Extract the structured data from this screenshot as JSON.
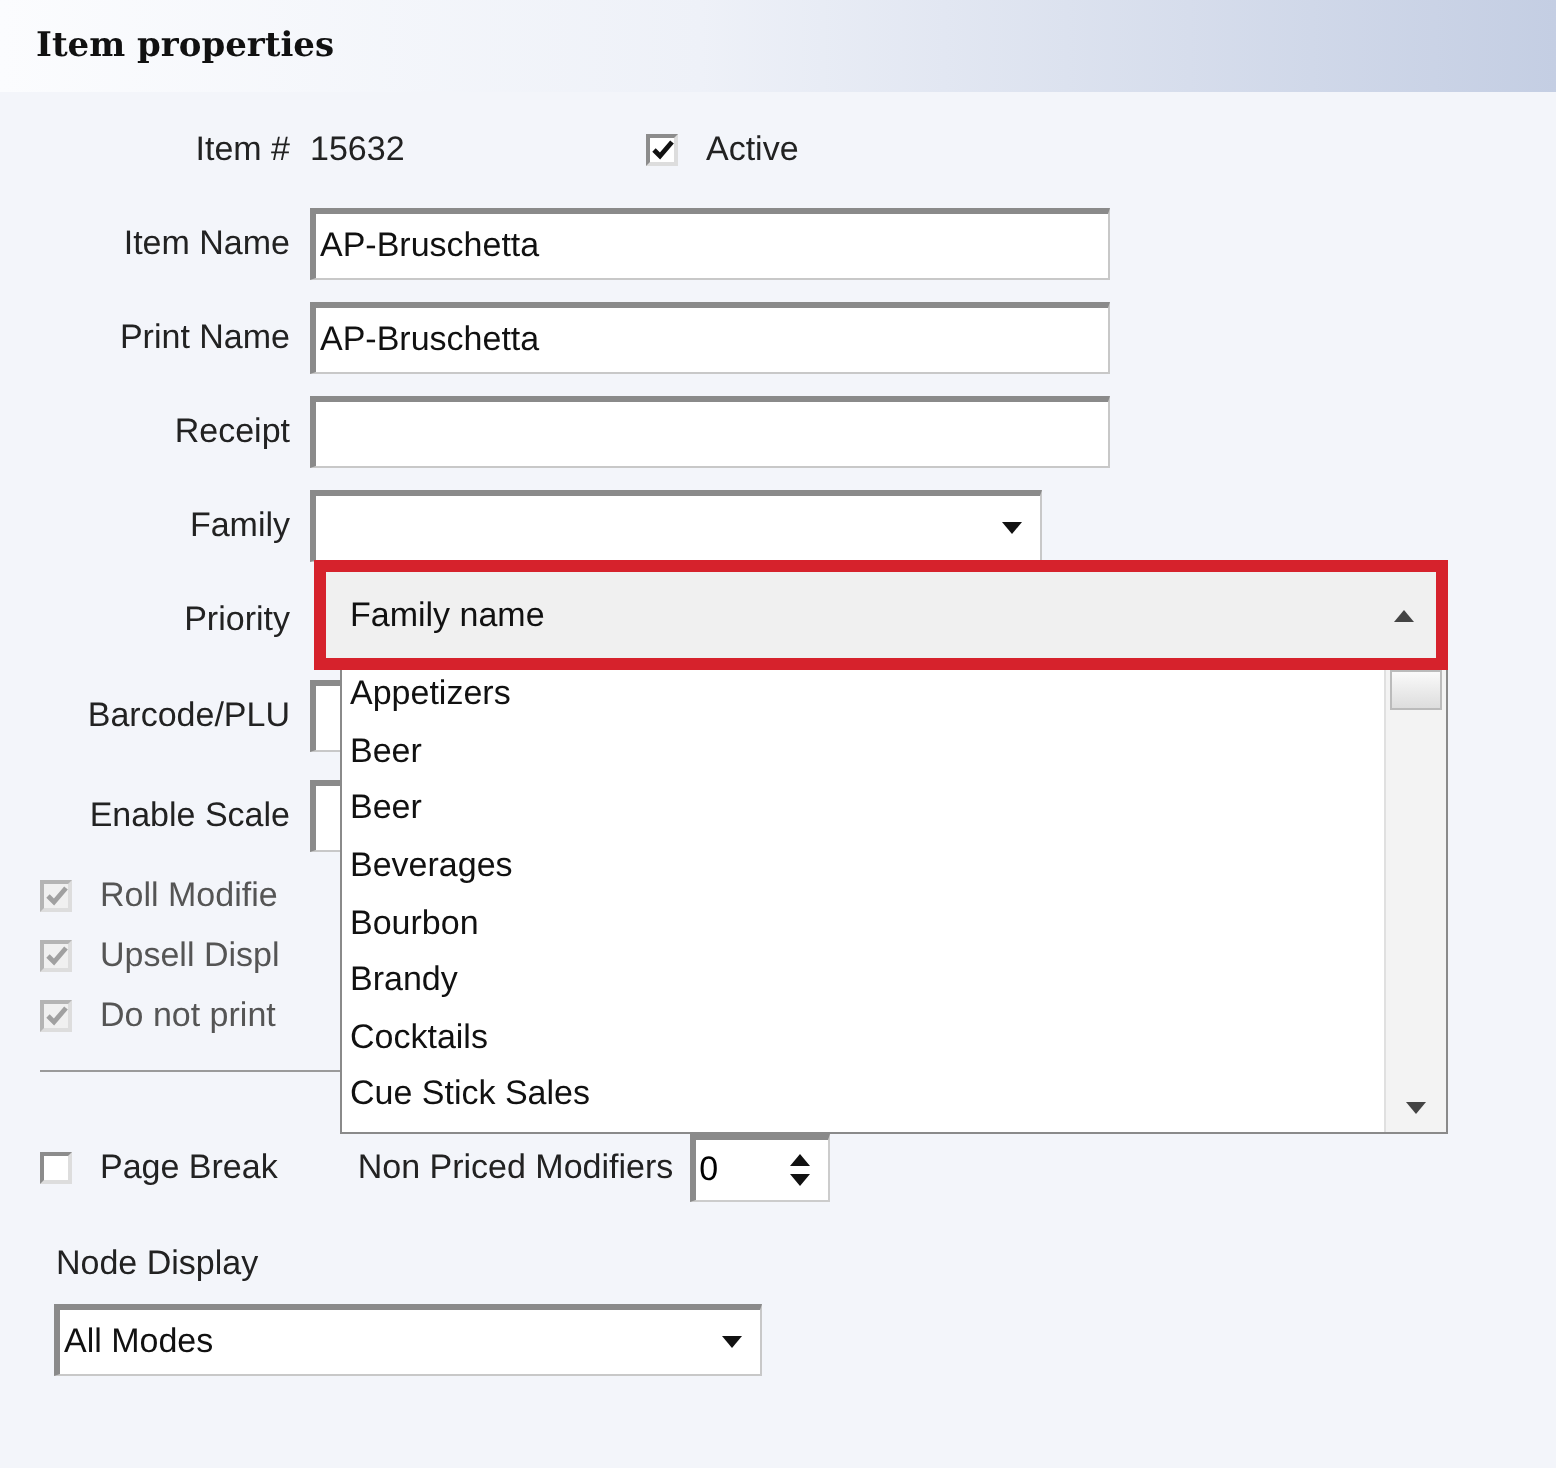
{
  "panel": {
    "title": "Item properties"
  },
  "item_number": {
    "label": "Item #",
    "value": "15632"
  },
  "active": {
    "label": "Active",
    "checked": true
  },
  "fields": [
    {
      "label": "Item Name",
      "kind": "text",
      "value": "AP-Bruschetta"
    },
    {
      "label": "Print Name",
      "kind": "text",
      "value": "AP-Bruschetta"
    },
    {
      "label": "Receipt",
      "kind": "text"
    },
    {
      "label": "Family",
      "kind": "combo"
    },
    {
      "label": "Priority",
      "kind": "covered"
    },
    {
      "label": "Barcode/PLU",
      "kind": "text"
    },
    {
      "label": "Enable Scale",
      "kind": "text"
    }
  ],
  "options": [
    {
      "label": "Roll Modifie",
      "checked": true,
      "disabled": true
    },
    {
      "label": "Upsell Displ",
      "checked": true,
      "disabled": true
    },
    {
      "label": "Do not print",
      "checked": true,
      "disabled": true
    }
  ],
  "dropdown": {
    "header": "Family name",
    "highlighted": true,
    "items": [
      "Appetizers",
      "Beer",
      "Beer",
      "Beverages",
      "Bourbon",
      "Brandy",
      "Cocktails",
      "Cue Stick Sales"
    ]
  },
  "page_break": {
    "label": "Page Break",
    "checked": false
  },
  "non_priced_modifiers": {
    "label": "Non Priced Modifiers",
    "value": "0"
  },
  "node_display": {
    "label": "Node Display",
    "value": "All Modes"
  }
}
